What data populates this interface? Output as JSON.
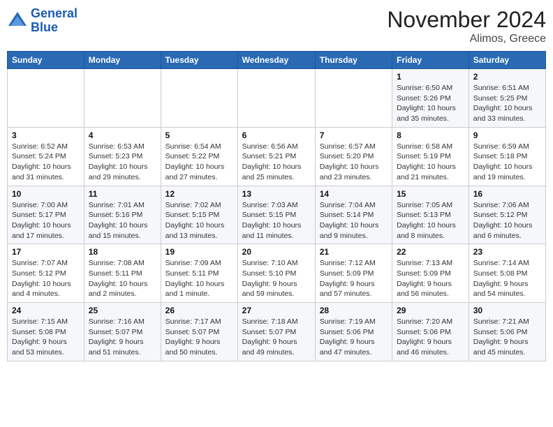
{
  "header": {
    "logo_line1": "General",
    "logo_line2": "Blue",
    "month_year": "November 2024",
    "location": "Alimos, Greece"
  },
  "weekdays": [
    "Sunday",
    "Monday",
    "Tuesday",
    "Wednesday",
    "Thursday",
    "Friday",
    "Saturday"
  ],
  "weeks": [
    [
      {
        "day": "",
        "info": ""
      },
      {
        "day": "",
        "info": ""
      },
      {
        "day": "",
        "info": ""
      },
      {
        "day": "",
        "info": ""
      },
      {
        "day": "",
        "info": ""
      },
      {
        "day": "1",
        "info": "Sunrise: 6:50 AM\nSunset: 5:26 PM\nDaylight: 10 hours and 35 minutes."
      },
      {
        "day": "2",
        "info": "Sunrise: 6:51 AM\nSunset: 5:25 PM\nDaylight: 10 hours and 33 minutes."
      }
    ],
    [
      {
        "day": "3",
        "info": "Sunrise: 6:52 AM\nSunset: 5:24 PM\nDaylight: 10 hours and 31 minutes."
      },
      {
        "day": "4",
        "info": "Sunrise: 6:53 AM\nSunset: 5:23 PM\nDaylight: 10 hours and 29 minutes."
      },
      {
        "day": "5",
        "info": "Sunrise: 6:54 AM\nSunset: 5:22 PM\nDaylight: 10 hours and 27 minutes."
      },
      {
        "day": "6",
        "info": "Sunrise: 6:56 AM\nSunset: 5:21 PM\nDaylight: 10 hours and 25 minutes."
      },
      {
        "day": "7",
        "info": "Sunrise: 6:57 AM\nSunset: 5:20 PM\nDaylight: 10 hours and 23 minutes."
      },
      {
        "day": "8",
        "info": "Sunrise: 6:58 AM\nSunset: 5:19 PM\nDaylight: 10 hours and 21 minutes."
      },
      {
        "day": "9",
        "info": "Sunrise: 6:59 AM\nSunset: 5:18 PM\nDaylight: 10 hours and 19 minutes."
      }
    ],
    [
      {
        "day": "10",
        "info": "Sunrise: 7:00 AM\nSunset: 5:17 PM\nDaylight: 10 hours and 17 minutes."
      },
      {
        "day": "11",
        "info": "Sunrise: 7:01 AM\nSunset: 5:16 PM\nDaylight: 10 hours and 15 minutes."
      },
      {
        "day": "12",
        "info": "Sunrise: 7:02 AM\nSunset: 5:15 PM\nDaylight: 10 hours and 13 minutes."
      },
      {
        "day": "13",
        "info": "Sunrise: 7:03 AM\nSunset: 5:15 PM\nDaylight: 10 hours and 11 minutes."
      },
      {
        "day": "14",
        "info": "Sunrise: 7:04 AM\nSunset: 5:14 PM\nDaylight: 10 hours and 9 minutes."
      },
      {
        "day": "15",
        "info": "Sunrise: 7:05 AM\nSunset: 5:13 PM\nDaylight: 10 hours and 8 minutes."
      },
      {
        "day": "16",
        "info": "Sunrise: 7:06 AM\nSunset: 5:12 PM\nDaylight: 10 hours and 6 minutes."
      }
    ],
    [
      {
        "day": "17",
        "info": "Sunrise: 7:07 AM\nSunset: 5:12 PM\nDaylight: 10 hours and 4 minutes."
      },
      {
        "day": "18",
        "info": "Sunrise: 7:08 AM\nSunset: 5:11 PM\nDaylight: 10 hours and 2 minutes."
      },
      {
        "day": "19",
        "info": "Sunrise: 7:09 AM\nSunset: 5:11 PM\nDaylight: 10 hours and 1 minute."
      },
      {
        "day": "20",
        "info": "Sunrise: 7:10 AM\nSunset: 5:10 PM\nDaylight: 9 hours and 59 minutes."
      },
      {
        "day": "21",
        "info": "Sunrise: 7:12 AM\nSunset: 5:09 PM\nDaylight: 9 hours and 57 minutes."
      },
      {
        "day": "22",
        "info": "Sunrise: 7:13 AM\nSunset: 5:09 PM\nDaylight: 9 hours and 56 minutes."
      },
      {
        "day": "23",
        "info": "Sunrise: 7:14 AM\nSunset: 5:08 PM\nDaylight: 9 hours and 54 minutes."
      }
    ],
    [
      {
        "day": "24",
        "info": "Sunrise: 7:15 AM\nSunset: 5:08 PM\nDaylight: 9 hours and 53 minutes."
      },
      {
        "day": "25",
        "info": "Sunrise: 7:16 AM\nSunset: 5:07 PM\nDaylight: 9 hours and 51 minutes."
      },
      {
        "day": "26",
        "info": "Sunrise: 7:17 AM\nSunset: 5:07 PM\nDaylight: 9 hours and 50 minutes."
      },
      {
        "day": "27",
        "info": "Sunrise: 7:18 AM\nSunset: 5:07 PM\nDaylight: 9 hours and 49 minutes."
      },
      {
        "day": "28",
        "info": "Sunrise: 7:19 AM\nSunset: 5:06 PM\nDaylight: 9 hours and 47 minutes."
      },
      {
        "day": "29",
        "info": "Sunrise: 7:20 AM\nSunset: 5:06 PM\nDaylight: 9 hours and 46 minutes."
      },
      {
        "day": "30",
        "info": "Sunrise: 7:21 AM\nSunset: 5:06 PM\nDaylight: 9 hours and 45 minutes."
      }
    ]
  ]
}
